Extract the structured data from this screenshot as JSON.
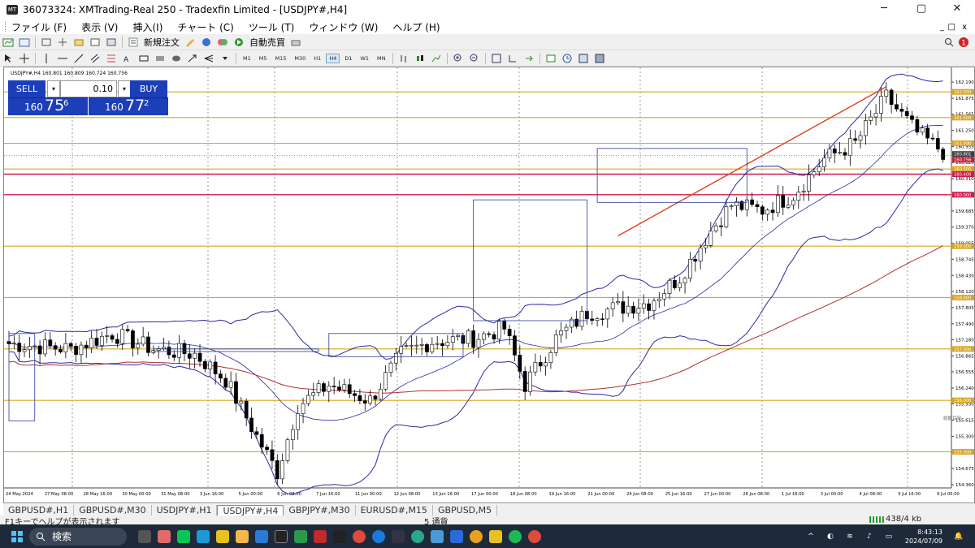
{
  "window": {
    "title": "36073324: XMTrading-Real 250 - Tradexfin Limited - [USDJPY#,H4]",
    "min": "─",
    "max": "▢",
    "close": "✕",
    "inner_min": "_",
    "inner_max": "□",
    "inner_close": "x"
  },
  "menu": [
    "ファイル (F)",
    "表示 (V)",
    "挿入(I)",
    "チャート (C)",
    "ツール (T)",
    "ウィンドウ (W)",
    "ヘルプ (H)"
  ],
  "toolbar1": {
    "new_order": "新規注文",
    "auto_trade": "自動売買"
  },
  "timeframes": [
    "M1",
    "M5",
    "M15",
    "M30",
    "H1",
    "H4",
    "D1",
    "W1",
    "MN"
  ],
  "active_timeframe": "H4",
  "chart_header": "USDJPY#,H4  160.801 160.809 160.724 160.756",
  "trade_panel": {
    "sell_label": "SELL",
    "buy_label": "BUY",
    "lot": "0.10",
    "dd": "▾",
    "sell_big": "160",
    "sell_pips": "75",
    "sell_frac": "6",
    "buy_big": "160",
    "buy_pips": "77",
    "buy_frac": "2"
  },
  "chart_data": {
    "type": "candlestick",
    "symbol": "USDJPY#",
    "timeframe": "H4",
    "ylim": [
      154.36,
      162.35
    ],
    "y_ticks": [
      162.19,
      161.875,
      161.565,
      161.25,
      160.935,
      160.625,
      160.31,
      159.685,
      159.37,
      159.055,
      158.745,
      158.43,
      158.12,
      157.805,
      157.49,
      157.18,
      156.865,
      156.555,
      156.24,
      155.93,
      155.615,
      155.3,
      154.99,
      154.675,
      154.36
    ],
    "y_tick_labels": [
      "162.190",
      "161.875",
      "161.565",
      "161.250",
      "160.935",
      "160.625",
      "160.310",
      "159.685",
      "159.370",
      "159.055",
      "158.745",
      "158.430",
      "158.120",
      "157.805",
      "157.490",
      "157.180",
      "156.865",
      "156.555",
      "156.240",
      "155.930",
      "155.615",
      "155.300",
      "154.990",
      "154.675",
      "154.360"
    ],
    "x_labels": [
      "24 May 2024",
      "27 May 08:00",
      "28 May 16:00",
      "30 May 00:00",
      "31 May 08:00",
      "3 Jun 16:00",
      "5 Jun 00:00",
      "6 Jun 08:00",
      "7 Jun 16:00",
      "11 Jun 00:00",
      "12 Jun 08:00",
      "13 Jun 16:00",
      "17 Jun 00:00",
      "18 Jun 08:00",
      "19 Jun 16:00",
      "21 Jun 00:00",
      "24 Jun 08:00",
      "25 Jun 16:00",
      "27 Jun 00:00",
      "28 Jun 08:00",
      "1 Jul 16:00",
      "3 Jul 00:00",
      "4 Jul 08:00",
      "5 Jul 16:00",
      "9 Jul 00:00"
    ],
    "bar_count": 182,
    "close_anchors": [
      [
        0,
        157.1
      ],
      [
        12,
        157.0
      ],
      [
        20,
        157.3
      ],
      [
        28,
        157.0
      ],
      [
        36,
        156.9
      ],
      [
        42,
        156.4
      ],
      [
        48,
        155.3
      ],
      [
        52,
        154.6
      ],
      [
        56,
        155.9
      ],
      [
        62,
        156.3
      ],
      [
        70,
        156.0
      ],
      [
        76,
        156.9
      ],
      [
        82,
        157.15
      ],
      [
        90,
        157.2
      ],
      [
        96,
        157.4
      ],
      [
        100,
        156.3
      ],
      [
        106,
        157.2
      ],
      [
        112,
        157.7
      ],
      [
        118,
        157.8
      ],
      [
        124,
        157.9
      ],
      [
        130,
        158.4
      ],
      [
        136,
        159.3
      ],
      [
        140,
        159.8
      ],
      [
        146,
        159.7
      ],
      [
        152,
        160.0
      ],
      [
        158,
        160.7
      ],
      [
        164,
        161.0
      ],
      [
        170,
        161.9
      ],
      [
        176,
        161.2
      ],
      [
        182,
        160.76
      ]
    ],
    "levels": [
      {
        "price": 162.0,
        "color": "#d9a520",
        "label": "162.000"
      },
      {
        "price": 161.5,
        "color": "#d9a520",
        "label": "161.500"
      },
      {
        "price": 161.0,
        "color": "#d9a520",
        "label": "161.000"
      },
      {
        "price": 160.5,
        "color": "#d9a520",
        "label": "160.500"
      },
      {
        "price": 160.4,
        "color": "#d11a4b",
        "label": "160.400"
      },
      {
        "price": 160.0,
        "color": "#d11a4b",
        "label": "160.000"
      },
      {
        "price": 159.0,
        "color": "#d9a520",
        "label": "159.000"
      },
      {
        "price": 158.0,
        "color": "#d9a520",
        "label": "158.000"
      },
      {
        "price": 157.0,
        "color": "#d9a520",
        "label": "157.000"
      },
      {
        "price": 156.0,
        "color": "#d9a520",
        "label": "156.000"
      },
      {
        "price": 155.0,
        "color": "#d9a520",
        "label": "155.000"
      }
    ],
    "bid_ask_labels": [
      "160.801",
      "160.756"
    ],
    "overlay_label": "総額目安",
    "grid": true,
    "background": "#ffffff",
    "bull_color": "#ffffff",
    "bear_color": "#000000",
    "bollinger_color": "#2a2aa8",
    "ma_color": "#b03030"
  },
  "tabs": [
    "GBPUSD#,H1",
    "GBPUSD#,M30",
    "USDJPY#,H1",
    "USDJPY#,H4",
    "GBPJPY#,M30",
    "EURUSD#,M15",
    "GBPUSD,M5"
  ],
  "active_tab": "USDJPY#,H4",
  "status": {
    "help": "F1キーでヘルプが表示されます",
    "currency": "5 通貨",
    "kb": "438/4 kb"
  },
  "taskbar": {
    "search": "検索",
    "time": "8:43:13",
    "date": "2024/07/09"
  }
}
